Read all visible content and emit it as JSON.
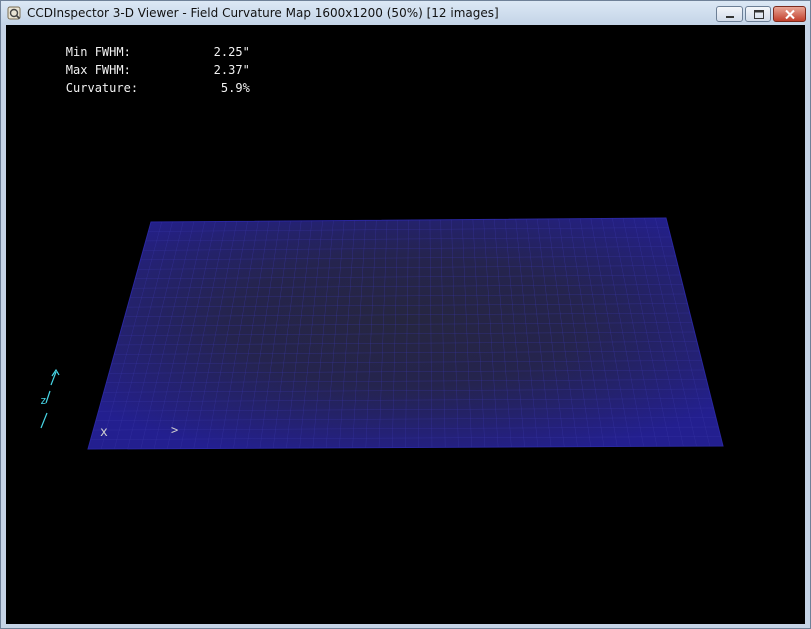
{
  "window": {
    "title": "CCDInspector 3-D Viewer - Field Curvature Map 1600x1200 (50%)  [12 images]",
    "controls": {
      "minimize_icon": "minimize-icon",
      "maximize_icon": "maximize-icon",
      "close_icon": "close-icon"
    }
  },
  "stats": [
    {
      "label": "Min FWHM:",
      "value": "2.25\""
    },
    {
      "label": "Max FWHM:",
      "value": "2.37\""
    },
    {
      "label": "Curvature:",
      "value": "5.9%"
    }
  ],
  "axes": {
    "x_label": "x",
    "y_label": ">",
    "z_label": "z"
  },
  "colors": {
    "surface_edge": "#231f8f",
    "surface_center": "#262640",
    "grid_line": "#3a36a8",
    "axis_indicator": "#47d6e6",
    "text": "#f2f2f2"
  }
}
